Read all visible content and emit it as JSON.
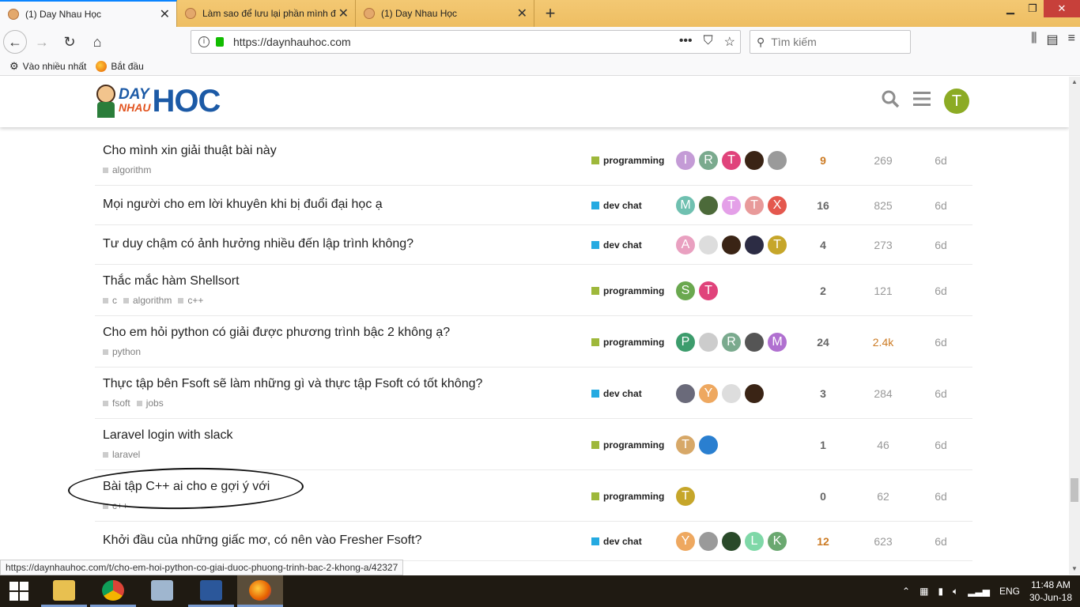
{
  "browser": {
    "tabs": [
      {
        "title": "(1) Day Nhau Học",
        "active": true
      },
      {
        "title": "Làm sao để lưu lại phần mình đ",
        "active": false
      },
      {
        "title": "(1) Day Nhau Học",
        "active": false
      }
    ],
    "url": "https://daynhauhoc.com",
    "search_placeholder": "Tìm kiếm",
    "bookmarks": [
      "Vào nhiều nhất",
      "Bắt đầu"
    ],
    "status_link": "https://daynhauhoc.com/t/cho-em-hoi-python-co-giai-duoc-phuong-trinh-bac-2-khong-a/42327"
  },
  "site": {
    "logo_day": "DAY",
    "logo_nhau": "NHAU",
    "logo_hoc": "HOC",
    "user_initial": "T"
  },
  "colors": {
    "programming": "#9eb83b",
    "dev_chat": "#25aae1",
    "hot": "#cc7b24"
  },
  "topics": [
    {
      "title": "Cho mình xin giải thuật bài này",
      "tags": [
        "algorithm"
      ],
      "category": "programming",
      "posters": [
        {
          "i": "I",
          "c": "#c49bd6"
        },
        {
          "i": "R",
          "c": "#7aaa8e"
        },
        {
          "i": "T",
          "c": "#e0437b"
        },
        {
          "i": "",
          "c": "#3a2415"
        },
        {
          "i": "",
          "c": "#9a9a9a"
        }
      ],
      "replies": "9",
      "views": "269",
      "activity": "6d",
      "replies_hot": true
    },
    {
      "title": "Mọi người cho em lời khuyên khi bị đuổi đại học ạ",
      "tags": [],
      "category": "dev chat",
      "posters": [
        {
          "i": "M",
          "c": "#6fc0b0"
        },
        {
          "i": "",
          "c": "#4c6a3a"
        },
        {
          "i": "T",
          "c": "#e4a0e8"
        },
        {
          "i": "T",
          "c": "#e89a9a"
        },
        {
          "i": "X",
          "c": "#e4584e"
        }
      ],
      "replies": "16",
      "views": "825",
      "activity": "6d"
    },
    {
      "title": "Tư duy chậm có ảnh hưởng nhiều đến lập trình không?",
      "tags": [],
      "category": "dev chat",
      "posters": [
        {
          "i": "A",
          "c": "#e9a0c0"
        },
        {
          "i": "",
          "c": "#dddddd"
        },
        {
          "i": "",
          "c": "#3a2415"
        },
        {
          "i": "",
          "c": "#2c2c44"
        },
        {
          "i": "T",
          "c": "#c6a62a"
        }
      ],
      "replies": "4",
      "views": "273",
      "activity": "6d"
    },
    {
      "title": "Thắc mắc hàm Shellsort",
      "tags": [
        "c",
        "algorithm",
        "c++"
      ],
      "category": "programming",
      "posters": [
        {
          "i": "S",
          "c": "#6aa84f"
        },
        {
          "i": "T",
          "c": "#e0437b"
        }
      ],
      "replies": "2",
      "views": "121",
      "activity": "6d"
    },
    {
      "title": "Cho em hỏi python có giải được phương trình bậc 2 không ạ?",
      "tags": [
        "python"
      ],
      "category": "programming",
      "posters": [
        {
          "i": "P",
          "c": "#3c9c6c"
        },
        {
          "i": "",
          "c": "#cccccc"
        },
        {
          "i": "R",
          "c": "#7aaa8e"
        },
        {
          "i": "",
          "c": "#555555"
        },
        {
          "i": "M",
          "c": "#b070d0"
        }
      ],
      "replies": "24",
      "views": "2.4k",
      "activity": "6d",
      "views_hot": true
    },
    {
      "title": "Thực tập bên Fsoft sẽ làm những gì và thực tập Fsoft có tốt không?",
      "tags": [
        "fsoft",
        "jobs"
      ],
      "category": "dev chat",
      "posters": [
        {
          "i": "",
          "c": "#6a6a7a"
        },
        {
          "i": "Y",
          "c": "#eea860"
        },
        {
          "i": "",
          "c": "#dddddd"
        },
        {
          "i": "",
          "c": "#3a2415"
        }
      ],
      "replies": "3",
      "views": "284",
      "activity": "6d"
    },
    {
      "title": "Laravel login with slack",
      "tags": [
        "laravel"
      ],
      "category": "programming",
      "posters": [
        {
          "i": "T",
          "c": "#d7a868"
        },
        {
          "i": "",
          "c": "#2a7fd0"
        }
      ],
      "replies": "1",
      "views": "46",
      "activity": "6d"
    },
    {
      "title": "Bài tập C++ ai cho e gợi ý với",
      "tags": [
        "c++"
      ],
      "category": "programming",
      "posters": [
        {
          "i": "T",
          "c": "#c6a62a"
        }
      ],
      "replies": "0",
      "views": "62",
      "activity": "6d"
    },
    {
      "title": "Khởi đầu của những giấc mơ, có nên vào Fresher Fsoft?",
      "tags": [],
      "category": "dev chat",
      "posters": [
        {
          "i": "Y",
          "c": "#eea860"
        },
        {
          "i": "",
          "c": "#9a9a9a"
        },
        {
          "i": "",
          "c": "#2a4a2a"
        },
        {
          "i": "L",
          "c": "#7fd8a8"
        },
        {
          "i": "K",
          "c": "#6aa870"
        }
      ],
      "replies": "12",
      "views": "623",
      "activity": "6d",
      "replies_hot": true
    }
  ],
  "taskbar": {
    "lang": "ENG",
    "time": "11:48 AM",
    "date": "30-Jun-18"
  }
}
